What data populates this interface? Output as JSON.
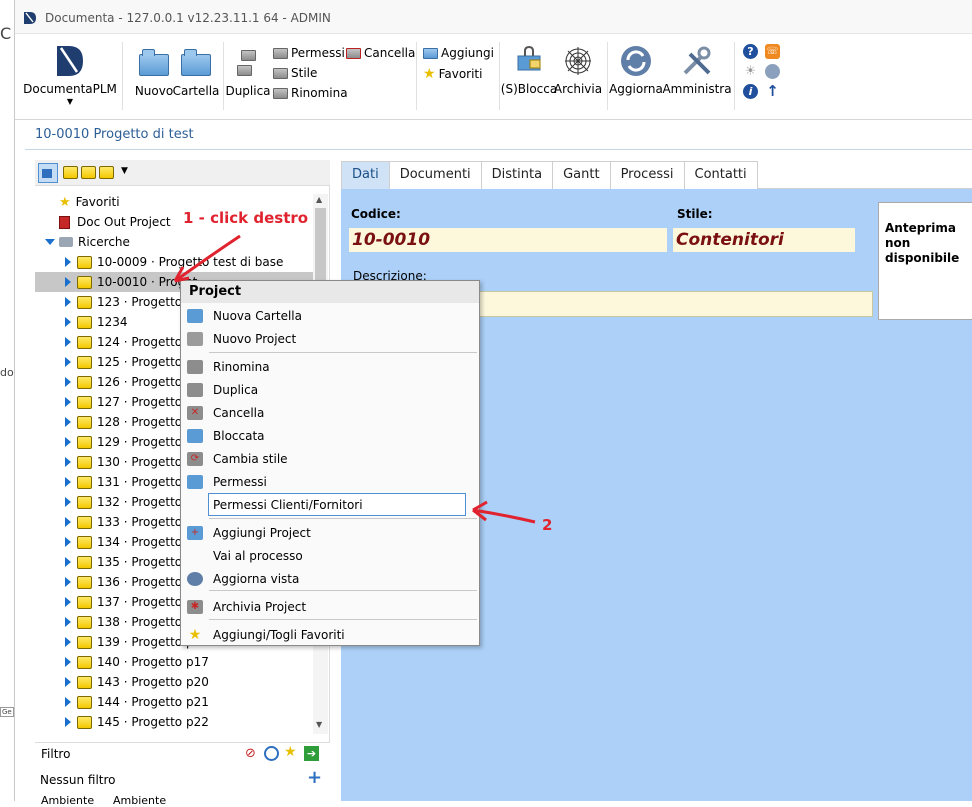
{
  "window": {
    "title": "Documenta - 127.0.0.1 v12.23.11.1 64 - ADMIN"
  },
  "edge_labels": {
    "c": "C",
    "do": "do",
    "ge": "Ge"
  },
  "ribbon": {
    "documenta_plm": "DocumentaPLM",
    "nuovo": "Nuovo",
    "cartella": "Cartella",
    "duplica": "Duplica",
    "permessi": "Permessi",
    "stile": "Stile",
    "rinomina": "Rinomina",
    "cancella": "Cancella",
    "aggiungi": "Aggiungi",
    "favoriti": "Favoriti",
    "sblocca": "(S)Blocca",
    "archivia": "Archivia",
    "aggiorna": "Aggiorna",
    "amministra": "Amministra"
  },
  "breadcrumb": "10-0010 Progetto di test",
  "tree": {
    "top": [
      {
        "label": "Favoriti"
      },
      {
        "label": "Doc Out Project"
      },
      {
        "label": "Ricerche"
      }
    ],
    "items": [
      {
        "label": "10-0009 · Progetto test di base"
      },
      {
        "label": "10-0010 · Proget"
      },
      {
        "label": "123 · Progetto p"
      },
      {
        "label": "1234"
      },
      {
        "label": "124 · Progetto p"
      },
      {
        "label": "125 · Progetto p"
      },
      {
        "label": "126 · Progetto p"
      },
      {
        "label": "127 · Progetto p"
      },
      {
        "label": "128 · Progetto p"
      },
      {
        "label": "129 · Progetto p"
      },
      {
        "label": "130 · Progetto p"
      },
      {
        "label": "131 · Progetto p"
      },
      {
        "label": "132 · Progetto p"
      },
      {
        "label": "133 · Progetto p"
      },
      {
        "label": "134 · Progetto p"
      },
      {
        "label": "135 · Progetto p"
      },
      {
        "label": "136 · Progetto p"
      },
      {
        "label": "137 · Progetto p"
      },
      {
        "label": "138 · Progetto p"
      },
      {
        "label": "139 · Progetto p"
      },
      {
        "label": "140 · Progetto p17"
      },
      {
        "label": "143 · Progetto p20"
      },
      {
        "label": "144 · Progetto p21"
      },
      {
        "label": "145 · Progetto p22"
      }
    ],
    "selected_index": 1
  },
  "filter": {
    "label": "Filtro",
    "value": "Nessun filtro",
    "add_glyph": "+",
    "bottom_tabs": [
      "Ambiente",
      "Ambiente"
    ]
  },
  "tabs": [
    "Dati",
    "Documenti",
    "Distinta",
    "Gantt",
    "Processi",
    "Contatti"
  ],
  "form": {
    "codice_label": "Codice:",
    "codice_value": "10-0010",
    "stile_label": "Stile:",
    "stile_value": "Contenitori",
    "descrizione_label": "Descrizione:",
    "preview_text": "Anteprima non disponibile"
  },
  "context_menu": {
    "title": "Project",
    "items": [
      {
        "label": "Nuova Cartella",
        "icon": "folder-blue-icon"
      },
      {
        "label": "Nuovo Project",
        "icon": "folder-gray-icon"
      },
      {
        "label": "Rinomina",
        "icon": "rename-icon"
      },
      {
        "label": "Duplica",
        "icon": "duplicate-icon"
      },
      {
        "label": "Cancella",
        "icon": "delete-icon"
      },
      {
        "label": "Bloccata",
        "icon": "lock-icon"
      },
      {
        "label": "Cambia stile",
        "icon": "style-icon"
      },
      {
        "label": "Permessi",
        "icon": "permissions-icon"
      },
      {
        "label": "Permessi Clienti/Fornitori",
        "icon": ""
      },
      {
        "label": "Aggiungi Project",
        "icon": "add-project-icon"
      },
      {
        "label": "Vai al processo",
        "icon": ""
      },
      {
        "label": "Aggiorna vista",
        "icon": "refresh-icon"
      },
      {
        "label": "Archivia Project",
        "icon": "archive-icon"
      },
      {
        "label": "Aggiungi/Togli Favoriti",
        "icon": "star-icon"
      }
    ]
  },
  "annotations": {
    "a1": "1 - click destro",
    "a2": "2"
  },
  "colors": {
    "accent": "#1a6fce",
    "annotation": "#e0232e",
    "content_bg": "#acd0f8",
    "field_bg": "#fdf8dc",
    "field_text": "#7a1010"
  }
}
